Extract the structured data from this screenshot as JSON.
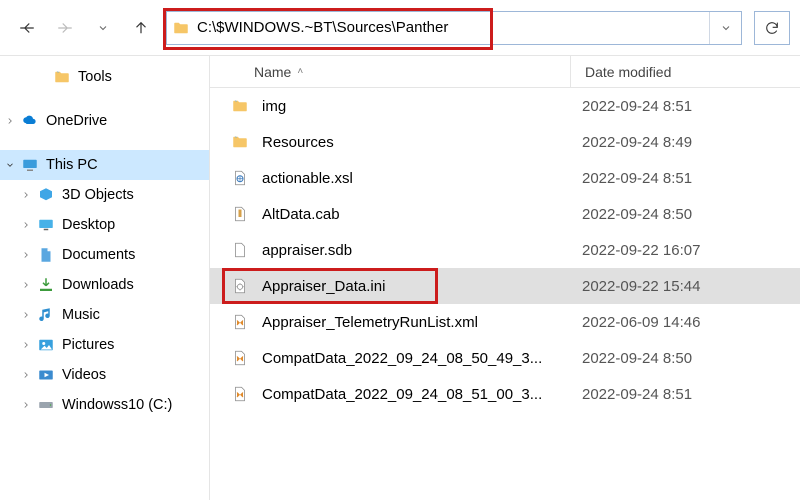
{
  "address": {
    "path": "C:\\$WINDOWS.~BT\\Sources\\Panther"
  },
  "columns": {
    "name": "Name",
    "date": "Date modified"
  },
  "sidebar": {
    "items": [
      {
        "label": "Tools",
        "icon": "folder",
        "indent": 2,
        "expander": ""
      },
      {
        "label": "",
        "icon": "",
        "indent": 0,
        "expander": "",
        "spacer": true
      },
      {
        "label": "OneDrive",
        "icon": "onedrive",
        "indent": 0,
        "expander": ">"
      },
      {
        "label": "",
        "icon": "",
        "indent": 0,
        "expander": "",
        "spacer": true
      },
      {
        "label": "This PC",
        "icon": "thispc",
        "indent": 0,
        "expander": "v",
        "selected": true
      },
      {
        "label": "3D Objects",
        "icon": "3d",
        "indent": 1,
        "expander": ">"
      },
      {
        "label": "Desktop",
        "icon": "desktop",
        "indent": 1,
        "expander": ">"
      },
      {
        "label": "Documents",
        "icon": "documents",
        "indent": 1,
        "expander": ">"
      },
      {
        "label": "Downloads",
        "icon": "downloads",
        "indent": 1,
        "expander": ">"
      },
      {
        "label": "Music",
        "icon": "music",
        "indent": 1,
        "expander": ">"
      },
      {
        "label": "Pictures",
        "icon": "pictures",
        "indent": 1,
        "expander": ">"
      },
      {
        "label": "Videos",
        "icon": "videos",
        "indent": 1,
        "expander": ">"
      },
      {
        "label": "Windowss10 (C:)",
        "icon": "drive",
        "indent": 1,
        "expander": ">"
      }
    ]
  },
  "files": [
    {
      "name": "img",
      "date": "2022-09-24 8:51",
      "icon": "folder"
    },
    {
      "name": "Resources",
      "date": "2022-09-24 8:49",
      "icon": "folder"
    },
    {
      "name": "actionable.xsl",
      "date": "2022-09-24 8:51",
      "icon": "xsl"
    },
    {
      "name": "AltData.cab",
      "date": "2022-09-24 8:50",
      "icon": "cab"
    },
    {
      "name": "appraiser.sdb",
      "date": "2022-09-22 16:07",
      "icon": "file"
    },
    {
      "name": "Appraiser_Data.ini",
      "date": "2022-09-22 15:44",
      "icon": "ini",
      "selected": true,
      "highlighted": true
    },
    {
      "name": "Appraiser_TelemetryRunList.xml",
      "date": "2022-06-09 14:46",
      "icon": "xml"
    },
    {
      "name": "CompatData_2022_09_24_08_50_49_3...",
      "date": "2022-09-24 8:50",
      "icon": "xml"
    },
    {
      "name": "CompatData_2022_09_24_08_51_00_3...",
      "date": "2022-09-24 8:51",
      "icon": "xml"
    }
  ]
}
